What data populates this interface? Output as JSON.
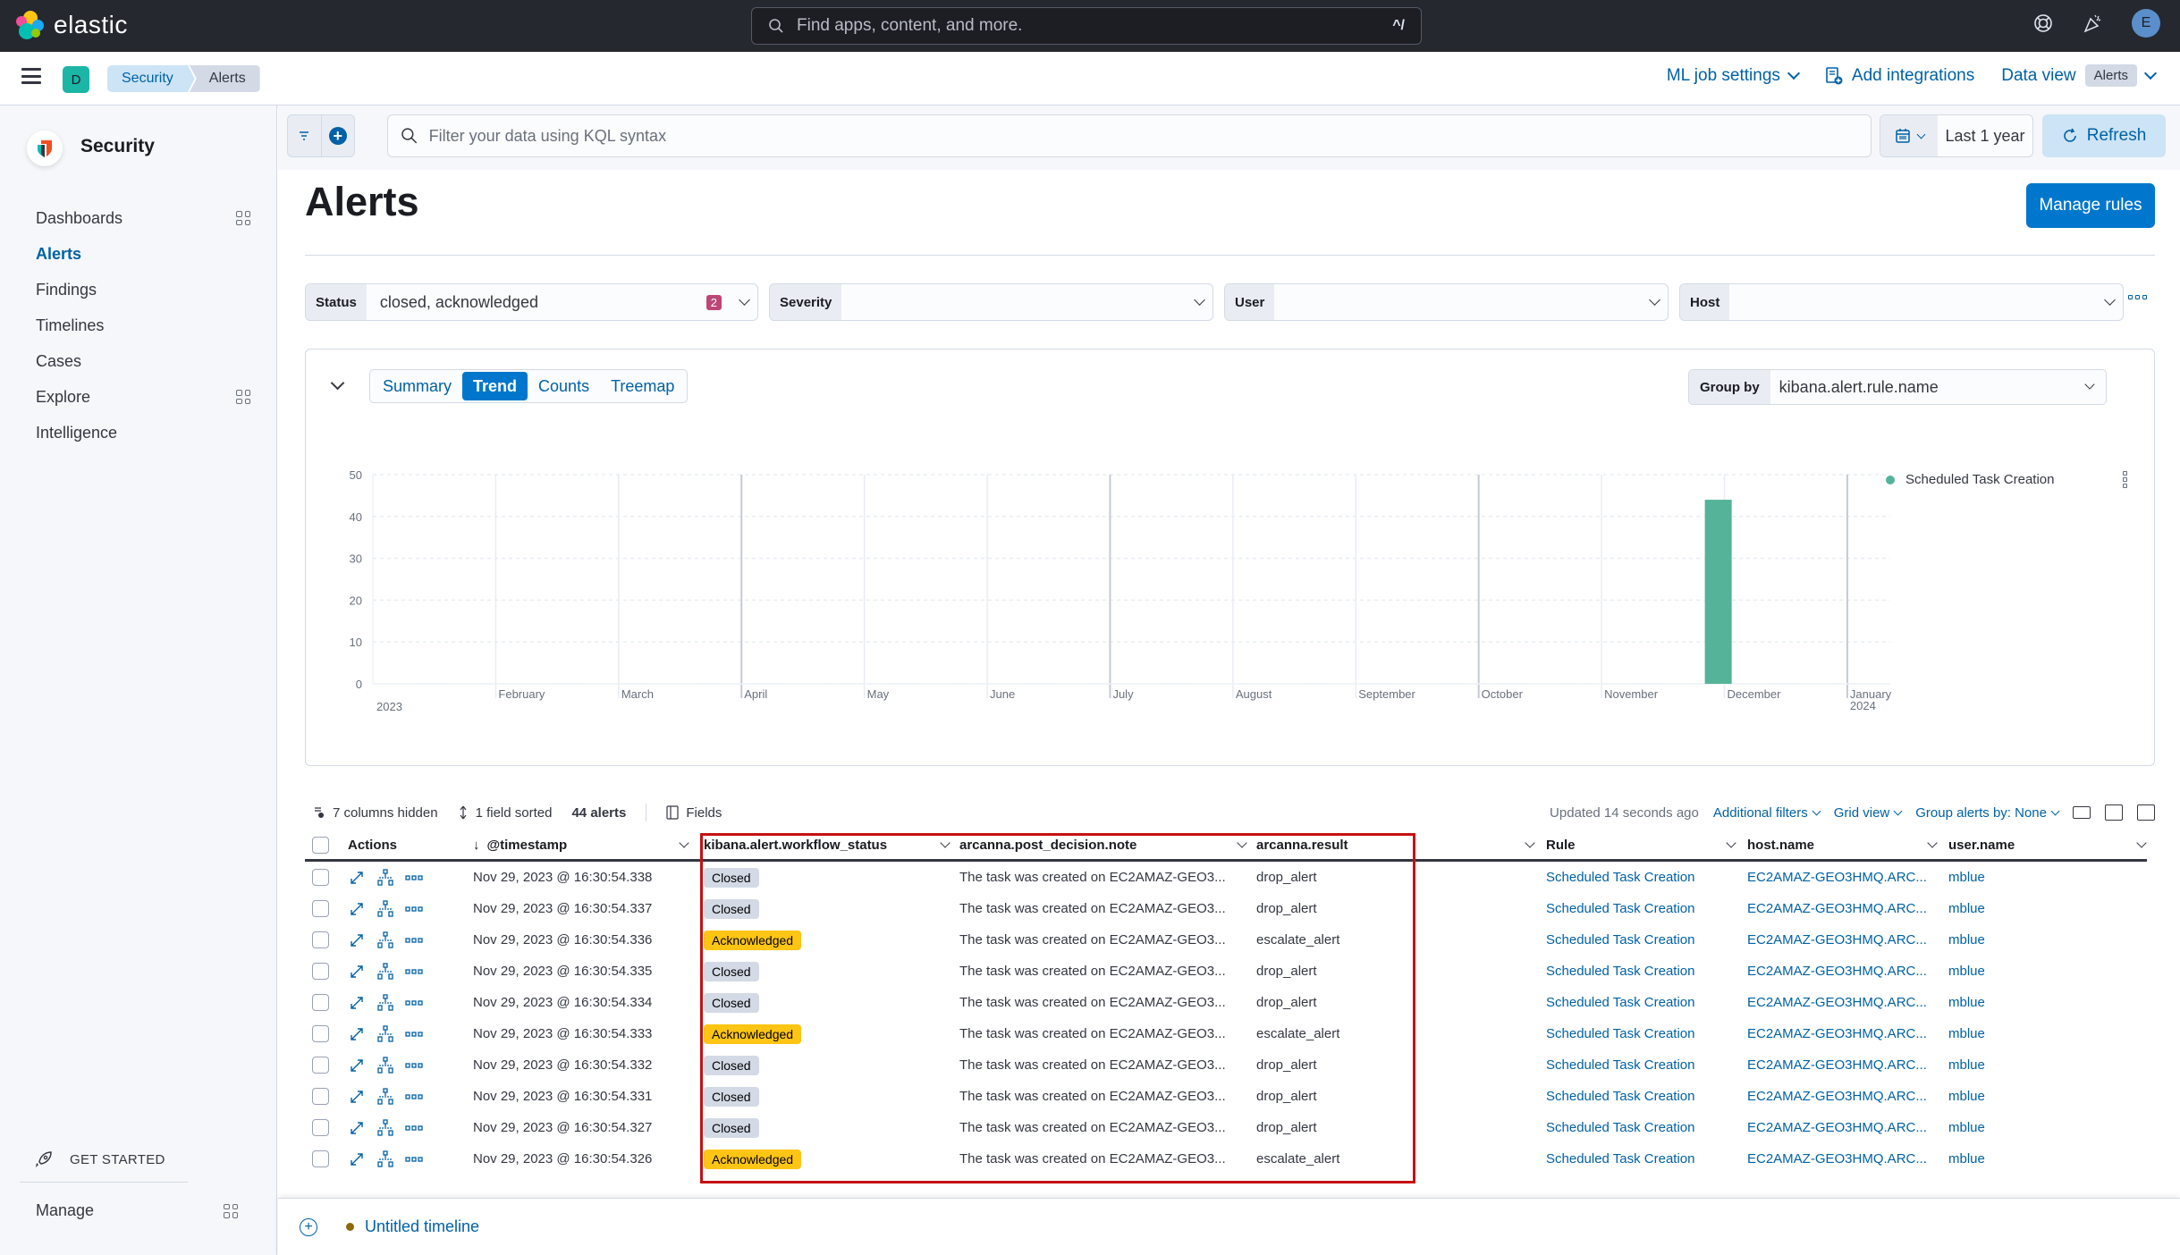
{
  "app": {
    "brand": "elastic",
    "global_search_placeholder": "Find apps, content, and more.",
    "global_search_shortcut": "^/",
    "user_initial": "E",
    "space_initial": "D"
  },
  "breadcrumbs": [
    "Security",
    "Alerts"
  ],
  "header_actions": {
    "ml_job_settings": "ML job settings",
    "add_integrations": "Add integrations",
    "data_view_label": "Data view",
    "data_view_value": "Alerts"
  },
  "sidebar": {
    "title": "Security",
    "items": [
      {
        "label": "Dashboards",
        "has_grid": true,
        "active": false
      },
      {
        "label": "Alerts",
        "has_grid": false,
        "active": true
      },
      {
        "label": "Findings",
        "has_grid": false,
        "active": false
      },
      {
        "label": "Timelines",
        "has_grid": false,
        "active": false
      },
      {
        "label": "Cases",
        "has_grid": false,
        "active": false
      },
      {
        "label": "Explore",
        "has_grid": true,
        "active": false
      },
      {
        "label": "Intelligence",
        "has_grid": false,
        "active": false
      }
    ],
    "get_started": "GET STARTED",
    "manage": "Manage"
  },
  "query_bar": {
    "placeholder": "Filter your data using KQL syntax",
    "date_range": "Last 1 year",
    "refresh": "Refresh"
  },
  "page": {
    "title": "Alerts",
    "manage_rules": "Manage rules"
  },
  "filters": [
    {
      "label": "Status",
      "value": "closed, acknowledged",
      "count": "2"
    },
    {
      "label": "Severity",
      "value": ""
    },
    {
      "label": "User",
      "value": ""
    },
    {
      "label": "Host",
      "value": ""
    }
  ],
  "chart_panel": {
    "tabs": [
      "Summary",
      "Trend",
      "Counts",
      "Treemap"
    ],
    "active_tab": "Trend",
    "group_by_label": "Group by",
    "group_by_value": "kibana.alert.rule.name"
  },
  "chart_data": {
    "type": "bar",
    "title": "",
    "xlabel": "",
    "ylabel": "",
    "ylim": [
      0,
      50
    ],
    "yticks": [
      0,
      10,
      20,
      30,
      40,
      50
    ],
    "x_ticks": [
      {
        "label": "2023",
        "month_index": 0
      },
      {
        "label": "February",
        "month_index": 1
      },
      {
        "label": "March",
        "month_index": 2
      },
      {
        "label": "April",
        "month_index": 3
      },
      {
        "label": "May",
        "month_index": 4
      },
      {
        "label": "June",
        "month_index": 5
      },
      {
        "label": "July",
        "month_index": 6
      },
      {
        "label": "August",
        "month_index": 7
      },
      {
        "label": "September",
        "month_index": 8
      },
      {
        "label": "October",
        "month_index": 9
      },
      {
        "label": "November",
        "month_index": 10
      },
      {
        "label": "December",
        "month_index": 11
      },
      {
        "label": "January",
        "sublabel": "2024",
        "month_index": 12
      }
    ],
    "x_range_months": [
      0,
      12.35
    ],
    "grid": true,
    "legend_position": "top-right",
    "series": [
      {
        "name": "Scheduled Task Creation",
        "color": "#54b399",
        "points": [
          {
            "x_month": 10.95,
            "value": 44
          }
        ]
      }
    ]
  },
  "table_toolbar": {
    "columns_hidden": "7 columns hidden",
    "fields_sorted": "1 field sorted",
    "alerts_count": "44 alerts",
    "fields": "Fields",
    "updated": "Updated 14 seconds ago",
    "additional_filters": "Additional filters",
    "grid_view": "Grid view",
    "group_alerts_by": "Group alerts by: None"
  },
  "table": {
    "columns": {
      "actions": "Actions",
      "timestamp": "@timestamp",
      "workflow_status": "kibana.alert.workflow_status",
      "post_decision_note": "arcanna.post_decision.note",
      "result": "arcanna.result",
      "rule": "Rule",
      "host": "host.name",
      "user": "user.name"
    },
    "rows": [
      {
        "timestamp": "Nov 29, 2023 @ 16:30:54.338",
        "status": "Closed",
        "note": "The task was created on EC2AMAZ-GEO3...",
        "result": "drop_alert",
        "rule": "Scheduled Task Creation",
        "host": "EC2AMAZ-GEO3HMQ.ARC...",
        "user": "mblue"
      },
      {
        "timestamp": "Nov 29, 2023 @ 16:30:54.337",
        "status": "Closed",
        "note": "The task was created on EC2AMAZ-GEO3...",
        "result": "drop_alert",
        "rule": "Scheduled Task Creation",
        "host": "EC2AMAZ-GEO3HMQ.ARC...",
        "user": "mblue"
      },
      {
        "timestamp": "Nov 29, 2023 @ 16:30:54.336",
        "status": "Acknowledged",
        "note": "The task was created on EC2AMAZ-GEO3...",
        "result": "escalate_alert",
        "rule": "Scheduled Task Creation",
        "host": "EC2AMAZ-GEO3HMQ.ARC...",
        "user": "mblue"
      },
      {
        "timestamp": "Nov 29, 2023 @ 16:30:54.335",
        "status": "Closed",
        "note": "The task was created on EC2AMAZ-GEO3...",
        "result": "drop_alert",
        "rule": "Scheduled Task Creation",
        "host": "EC2AMAZ-GEO3HMQ.ARC...",
        "user": "mblue"
      },
      {
        "timestamp": "Nov 29, 2023 @ 16:30:54.334",
        "status": "Closed",
        "note": "The task was created on EC2AMAZ-GEO3...",
        "result": "drop_alert",
        "rule": "Scheduled Task Creation",
        "host": "EC2AMAZ-GEO3HMQ.ARC...",
        "user": "mblue"
      },
      {
        "timestamp": "Nov 29, 2023 @ 16:30:54.333",
        "status": "Acknowledged",
        "note": "The task was created on EC2AMAZ-GEO3...",
        "result": "escalate_alert",
        "rule": "Scheduled Task Creation",
        "host": "EC2AMAZ-GEO3HMQ.ARC...",
        "user": "mblue"
      },
      {
        "timestamp": "Nov 29, 2023 @ 16:30:54.332",
        "status": "Closed",
        "note": "The task was created on EC2AMAZ-GEO3...",
        "result": "drop_alert",
        "rule": "Scheduled Task Creation",
        "host": "EC2AMAZ-GEO3HMQ.ARC...",
        "user": "mblue"
      },
      {
        "timestamp": "Nov 29, 2023 @ 16:30:54.331",
        "status": "Closed",
        "note": "The task was created on EC2AMAZ-GEO3...",
        "result": "drop_alert",
        "rule": "Scheduled Task Creation",
        "host": "EC2AMAZ-GEO3HMQ.ARC...",
        "user": "mblue"
      },
      {
        "timestamp": "Nov 29, 2023 @ 16:30:54.327",
        "status": "Closed",
        "note": "The task was created on EC2AMAZ-GEO3...",
        "result": "drop_alert",
        "rule": "Scheduled Task Creation",
        "host": "EC2AMAZ-GEO3HMQ.ARC...",
        "user": "mblue"
      },
      {
        "timestamp": "Nov 29, 2023 @ 16:30:54.326",
        "status": "Acknowledged",
        "note": "The task was created on EC2AMAZ-GEO3...",
        "result": "escalate_alert",
        "rule": "Scheduled Task Creation",
        "host": "EC2AMAZ-GEO3HMQ.ARC...",
        "user": "mblue"
      }
    ]
  },
  "timeline": {
    "name": "Untitled timeline"
  },
  "colors": {
    "accent": "#0077cc",
    "link": "#0061a6",
    "closed_badge": "#d3dae6",
    "acknowledged_badge": "#fec514",
    "status_count_badge": "#bd4678",
    "highlight_box": "#c61111"
  }
}
